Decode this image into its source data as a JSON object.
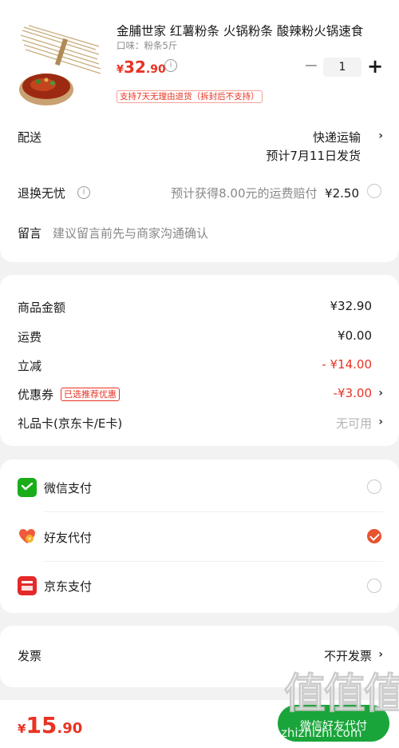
{
  "product": {
    "title": "金脯世家 红薯粉条 火锅粉条 酸辣粉火锅速食",
    "spec": "口味：粉条5斤",
    "price_symbol": "¥",
    "price_int": "32",
    "price_dec": ".90",
    "quantity": "1",
    "minus": "−",
    "plus": "+",
    "return_tag": "支持7天无理由退货（拆封后不支持）"
  },
  "delivery": {
    "label": "配送",
    "method": "快递运输",
    "estimate": "预计7月11日发货"
  },
  "worry_free": {
    "label": "退换无忧",
    "desc": "预计获得8.00元的运费赔付",
    "price": "¥2.50"
  },
  "message": {
    "label": "留言",
    "placeholder": "建议留言前先与商家沟通确认"
  },
  "summary": {
    "goods_label": "商品金额",
    "goods_value": "¥32.90",
    "shipping_label": "运费",
    "shipping_value": "¥0.00",
    "discount_label": "立减",
    "discount_value": "- ¥14.00",
    "coupon_label": "优惠券",
    "coupon_tag": "已选推荐优惠",
    "coupon_value": "-¥3.00",
    "giftcard_label": "礼品卡(京东卡/E卡)",
    "giftcard_value": "无可用"
  },
  "payment": {
    "options": [
      {
        "label": "微信支付",
        "icon": "wechat-pay-icon",
        "selected": false
      },
      {
        "label": "好友代付",
        "icon": "friend-pay-icon",
        "selected": true
      },
      {
        "label": "京东支付",
        "icon": "jd-pay-icon",
        "selected": false
      }
    ]
  },
  "invoice": {
    "label": "发票",
    "value": "不开发票"
  },
  "bottom": {
    "symbol": "¥",
    "total_int": "15",
    "total_dec": ".90",
    "button_label": "微信好友代付"
  },
  "watermark": {
    "text": "值值值",
    "url": "zhizhizhi.com"
  },
  "colors": {
    "accent": "#e93323",
    "wechat": "#1aad19",
    "jd": "#e4292a",
    "checked": "#e9522f"
  }
}
